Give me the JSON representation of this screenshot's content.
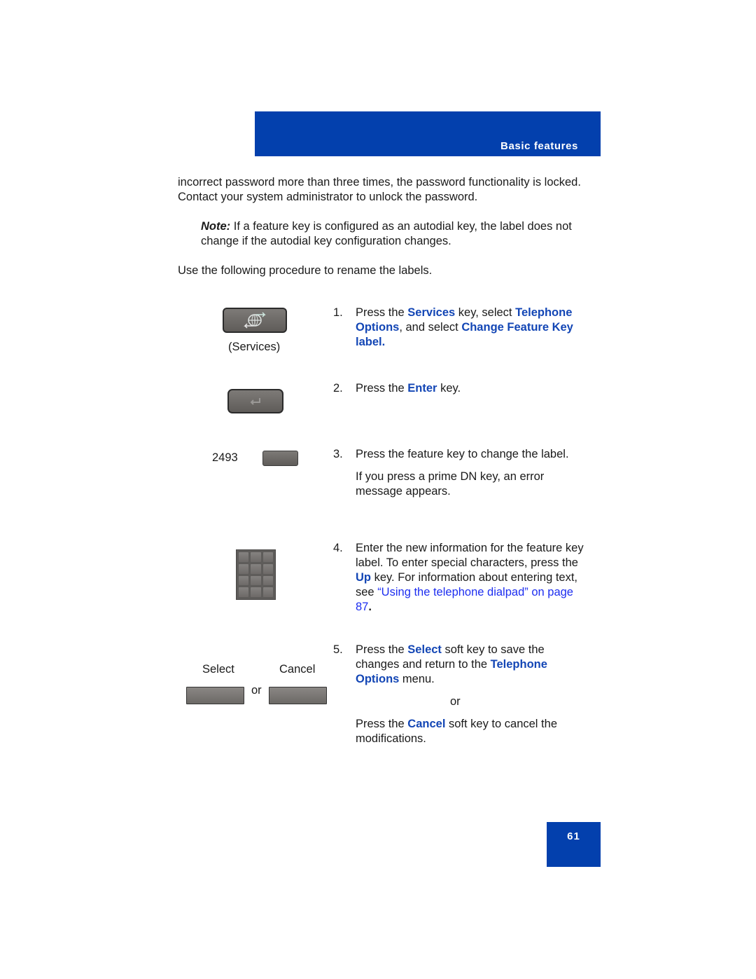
{
  "header": {
    "section_title": "Basic features"
  },
  "intro": {
    "paragraph": "incorrect password more than three times, the password functionality is locked. Contact your system administrator to unlock the password.",
    "note_label": "Note:",
    "note_text": " If a feature key is configured as an autodial key, the label does not change if the autodial key configuration changes.",
    "procedure_intro": "Use the following procedure to rename the labels."
  },
  "figures": {
    "services_caption": "(Services)",
    "services_icon": "services-globe-arrows-icon",
    "enter_icon": "enter-return-arrow-icon",
    "feature_key_number": "2493",
    "dialpad_icon": "dialpad-icon",
    "dialpad_keys": 12,
    "select_caption": "Select",
    "cancel_caption": "Cancel",
    "or_caption": "or"
  },
  "steps": [
    {
      "number": "1.",
      "parts": [
        "Press the ",
        "Services",
        " key, select ",
        "Telephone Options",
        ", and select ",
        "Change Feature Key label."
      ]
    },
    {
      "number": "2.",
      "parts": [
        "Press the ",
        "Enter",
        " key."
      ]
    },
    {
      "number": "3.",
      "text": "Press the feature key to change the label.",
      "subtext": "If you press a prime DN key, an error message appears."
    },
    {
      "number": "4.",
      "parts": [
        "Enter the new information for the feature key label. To enter special characters, press the ",
        "Up",
        " key. For information about entering text, see ",
        "“Using the telephone dialpad” on page 87",
        "."
      ]
    },
    {
      "number": "5.",
      "parts": [
        "Press the ",
        "Select",
        " soft key to save the changes and return to the ",
        "Telephone Options",
        " menu."
      ],
      "or": "or",
      "alt_parts": [
        "Press the ",
        "Cancel",
        " soft key to cancel the modifications."
      ]
    }
  ],
  "footer": {
    "page_number": "61"
  },
  "colors": {
    "brand_blue": "#0340ad",
    "keyword_blue": "#1346b5",
    "link_blue": "#1d2ef0"
  }
}
